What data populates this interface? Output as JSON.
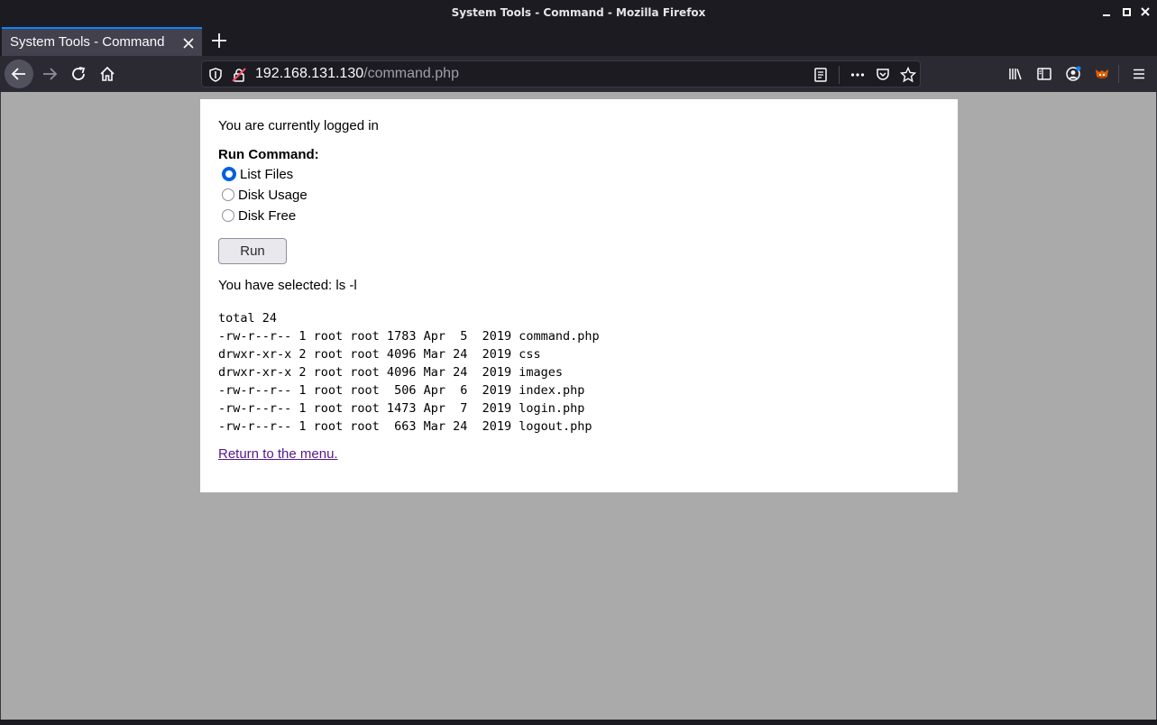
{
  "window": {
    "title": "System Tools - Command - Mozilla Firefox"
  },
  "tabs": [
    {
      "label": "System Tools - Command",
      "active": true
    }
  ],
  "urlbar": {
    "host": "192.168.131.130",
    "path": "/command.php"
  },
  "page": {
    "status": "You are currently logged in",
    "run_heading": "Run Command:",
    "options": [
      {
        "label": "List Files",
        "checked": true
      },
      {
        "label": "Disk Usage",
        "checked": false
      },
      {
        "label": "Disk Free",
        "checked": false
      }
    ],
    "run_button": "Run",
    "selected_text": "You have selected: ls -l",
    "output_lines": [
      "total 24",
      "-rw-r--r-- 1 root root 1783 Apr  5  2019 command.php",
      "drwxr-xr-x 2 root root 4096 Mar 24  2019 css",
      "drwxr-xr-x 2 root root 4096 Mar 24  2019 images",
      "-rw-r--r-- 1 root root  506 Apr  6  2019 index.php",
      "-rw-r--r-- 1 root root 1473 Apr  7  2019 login.php",
      "-rw-r--r-- 1 root root  663 Mar 24  2019 logout.php"
    ],
    "return_link": "Return to the menu."
  },
  "colors": {
    "chrome_dark": "#1c1b22",
    "toolbar": "#2b2a33",
    "tab_active": "#42414d",
    "accent": "#0a84ff",
    "page_bg": "#aaaaaa",
    "link_visited": "#551a8b"
  }
}
